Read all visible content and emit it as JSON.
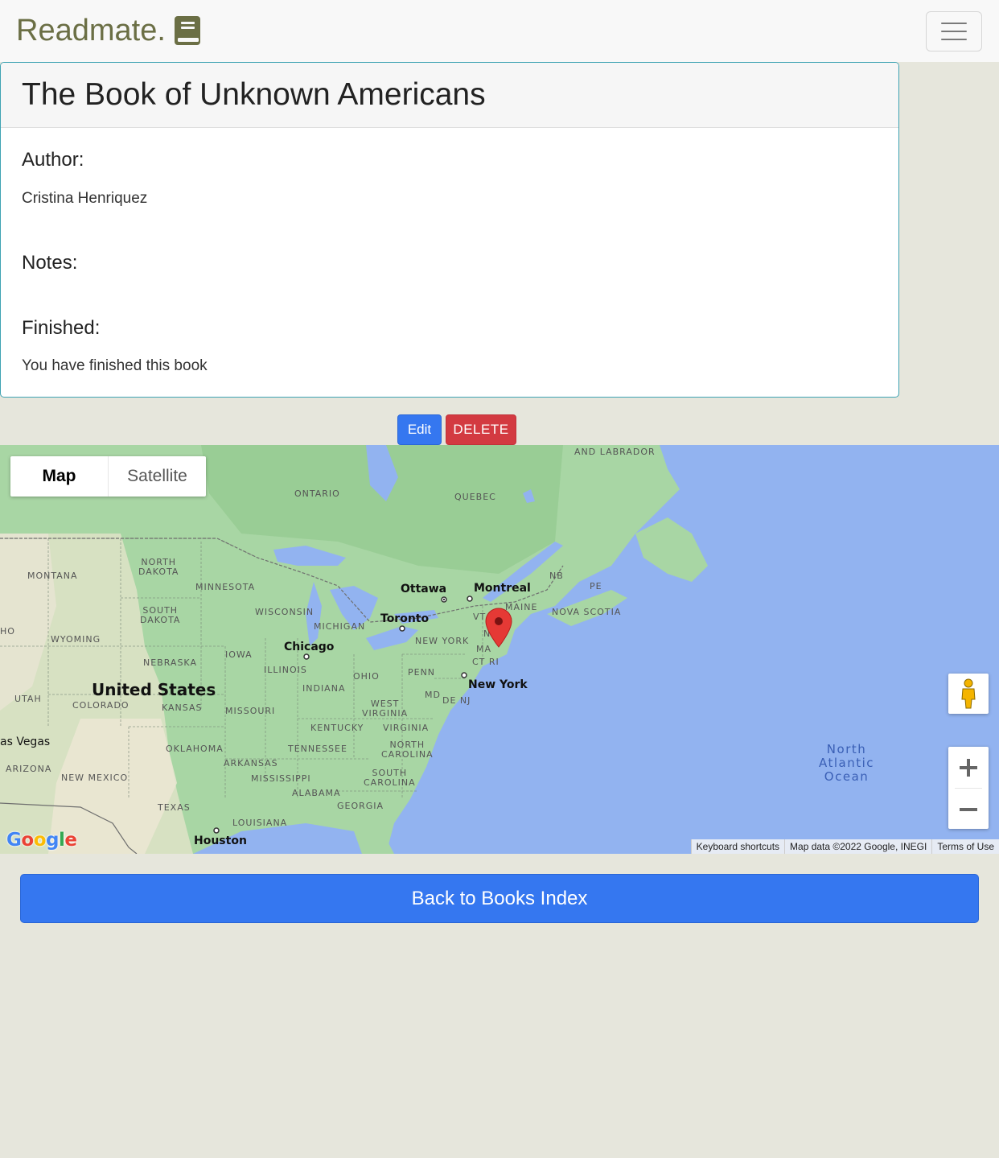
{
  "navbar": {
    "brand": "Readmate.",
    "brand_icon": "book-icon",
    "menu_icon": "hamburger-icon"
  },
  "book": {
    "title": "The Book of Unknown Americans",
    "author_label": "Author:",
    "author": "Cristina Henriquez",
    "notes_label": "Notes:",
    "notes": "",
    "finished_label": "Finished:",
    "finished": "You have finished this book"
  },
  "actions": {
    "edit": "Edit",
    "delete": "DELETE"
  },
  "map": {
    "type_map": "Map",
    "type_satellite": "Satellite",
    "google": "Google",
    "attribution": {
      "shortcuts": "Keyboard shortcuts",
      "data": "Map data ©2022 Google, INEGI",
      "terms": "Terms of Use"
    },
    "labels": {
      "labrador": "AND LABRADOR",
      "ontario": "ONTARIO",
      "quebec": "QUEBEC",
      "north_dakota": "NORTH\nDAKOTA",
      "montana": "MONTANA",
      "minnesota": "MINNESOTA",
      "nb": "NB",
      "pe": "PE",
      "ottawa": "Ottawa",
      "montreal": "Montreal",
      "south_dakota": "SOUTH\nDAKOTA",
      "wisconsin": "WISCONSIN",
      "toronto": "Toronto",
      "vt": "VT",
      "maine": "MAINE",
      "nova_scotia": "NOVA SCOTIA",
      "ho": "HO",
      "wyoming": "WYOMING",
      "michigan": "MICHIGAN",
      "new_york_state": "NEW YORK",
      "nh": "N",
      "ma": "MA",
      "chicago": "Chicago",
      "iowa": "IOWA",
      "nebraska": "NEBRASKA",
      "ct_ri": "CT RI",
      "illinois": "ILLINOIS",
      "ohio": "OHIO",
      "penn": "PENN",
      "united_states": "United States",
      "indiana": "INDIANA",
      "new_york_city": "New York",
      "utah": "UTAH",
      "colorado": "COLORADO",
      "kansas": "KANSAS",
      "missouri": "MISSOURI",
      "west_virginia": "WEST\nVIRGINIA",
      "md": "MD",
      "de_nj": "DE NJ",
      "kentucky": "KENTUCKY",
      "virginia": "VIRGINIA",
      "las_vegas": "as Vegas",
      "oklahoma": "OKLAHOMA",
      "tennessee": "TENNESSEE",
      "north_carolina": "NORTH\nCAROLINA",
      "ocean": "North\nAtlantic\nOcean",
      "arkansas": "ARKANSAS",
      "arizona": "ARIZONA",
      "new_mexico": "NEW MEXICO",
      "mississippi": "MISSISSIPPI",
      "south_carolina": "SOUTH\nCAROLINA",
      "alabama": "ALABAMA",
      "georgia": "GEORGIA",
      "texas": "TEXAS",
      "louisiana": "LOUISIANA",
      "houston": "Houston"
    }
  },
  "back": "Back to Books Index",
  "colors": {
    "primary": "#3577f0",
    "danger": "#d33a41",
    "brand": "#6b6f45",
    "card_border": "#3fa3b3",
    "page_bg": "#e6e6dc",
    "water": "#92b3f0",
    "land": "#a8d6a4",
    "marker": "#e53935"
  }
}
